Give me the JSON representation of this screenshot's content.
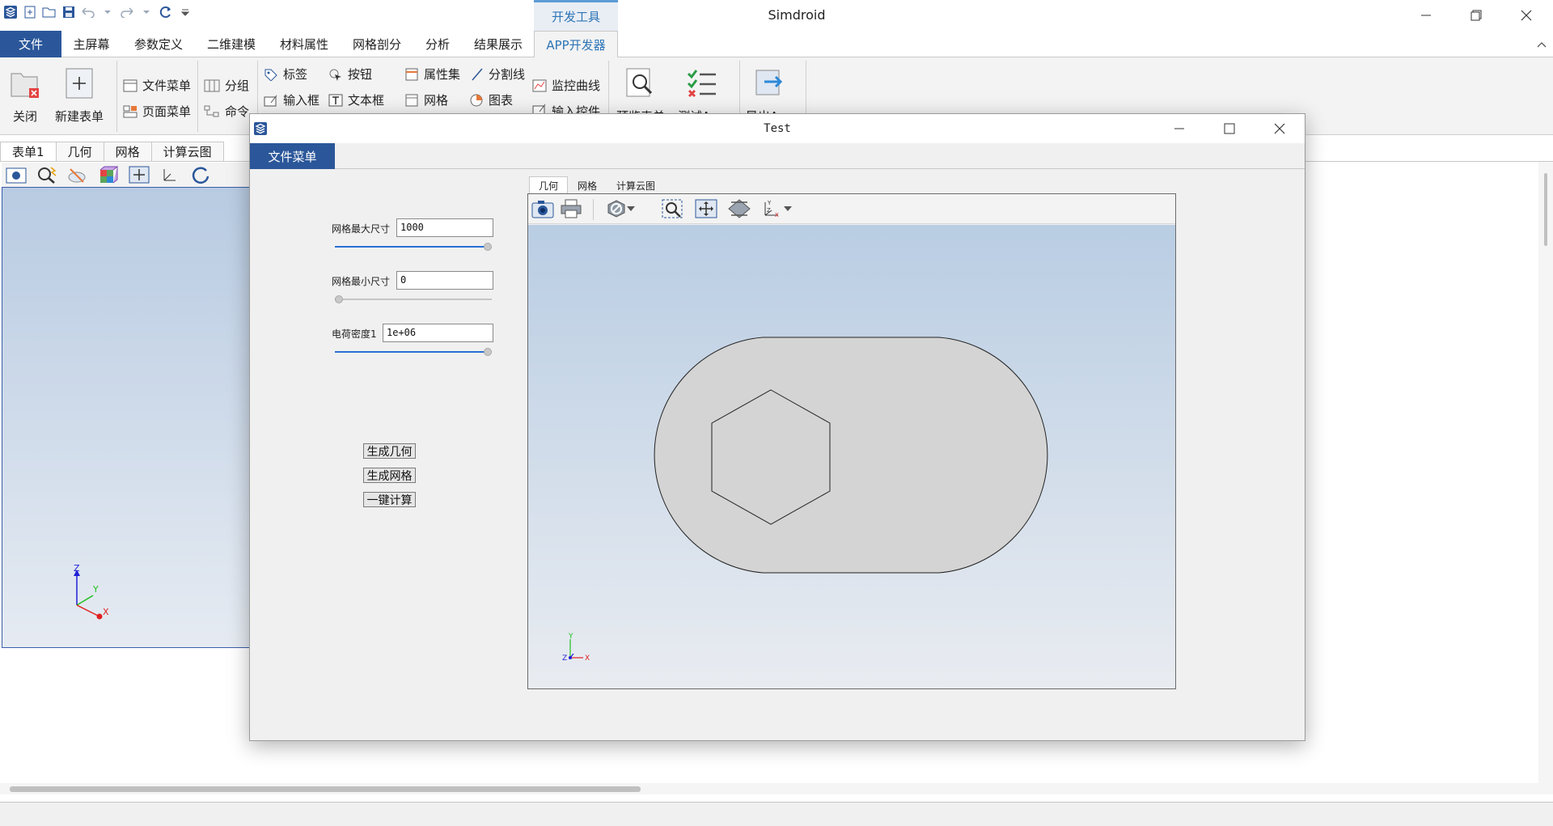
{
  "app": {
    "title": "Simdroid",
    "dev_tools_tab": "开发工具"
  },
  "menubar": {
    "file": "文件",
    "items": [
      "主屏幕",
      "参数定义",
      "二维建模",
      "材料属性",
      "网格剖分",
      "分析",
      "结果展示",
      "APP开发器"
    ]
  },
  "ribbon": {
    "close": "关闭",
    "new_form": "新建表单",
    "file_menu": "文件菜单",
    "page_menu": "页面菜单",
    "group": "分组",
    "command": "命令",
    "label": "标签",
    "button": "按钮",
    "property_set": "属性集",
    "divider": "分割线",
    "monitor_curve": "监控曲线",
    "input_box": "输入框",
    "text_box": "文本框",
    "mesh": "网格",
    "chart": "图表",
    "input_control": "输入控件",
    "preview_form": "预览表单",
    "test_app": "测试App",
    "export_app": "导出App"
  },
  "form_tabs": [
    "表单1",
    "几何",
    "网格",
    "计算云图"
  ],
  "axes": {
    "x": "X",
    "y": "Y",
    "z": "Z"
  },
  "dialog": {
    "title": "Test",
    "file_menu": "文件菜单",
    "fields": [
      {
        "label": "网格最大尺寸",
        "value": "1000",
        "slider": 1.0
      },
      {
        "label": "网格最小尺寸",
        "value": "0",
        "slider": 0.0
      },
      {
        "label": "电荷密度1",
        "value": "1e+06",
        "slider": 1.0
      }
    ],
    "buttons": {
      "gen_geometry": "生成几何",
      "gen_mesh": "生成网格",
      "one_click_calc": "一键计算"
    },
    "viewport_tabs": [
      "几何",
      "网格",
      "计算云图"
    ]
  },
  "colors": {
    "accent": "#2b579a",
    "tab_accent": "#2e75b6",
    "slider_fill": "#2a6fd6",
    "shape_fill": "#d4d4d4"
  },
  "icons": [
    "app-logo-icon",
    "new-icon",
    "open-icon",
    "save-icon",
    "undo-icon",
    "redo-icon",
    "refresh-icon",
    "camera-icon",
    "print-icon",
    "zoom-box-icon",
    "pan-icon",
    "fit-view-icon",
    "axis-icon"
  ]
}
